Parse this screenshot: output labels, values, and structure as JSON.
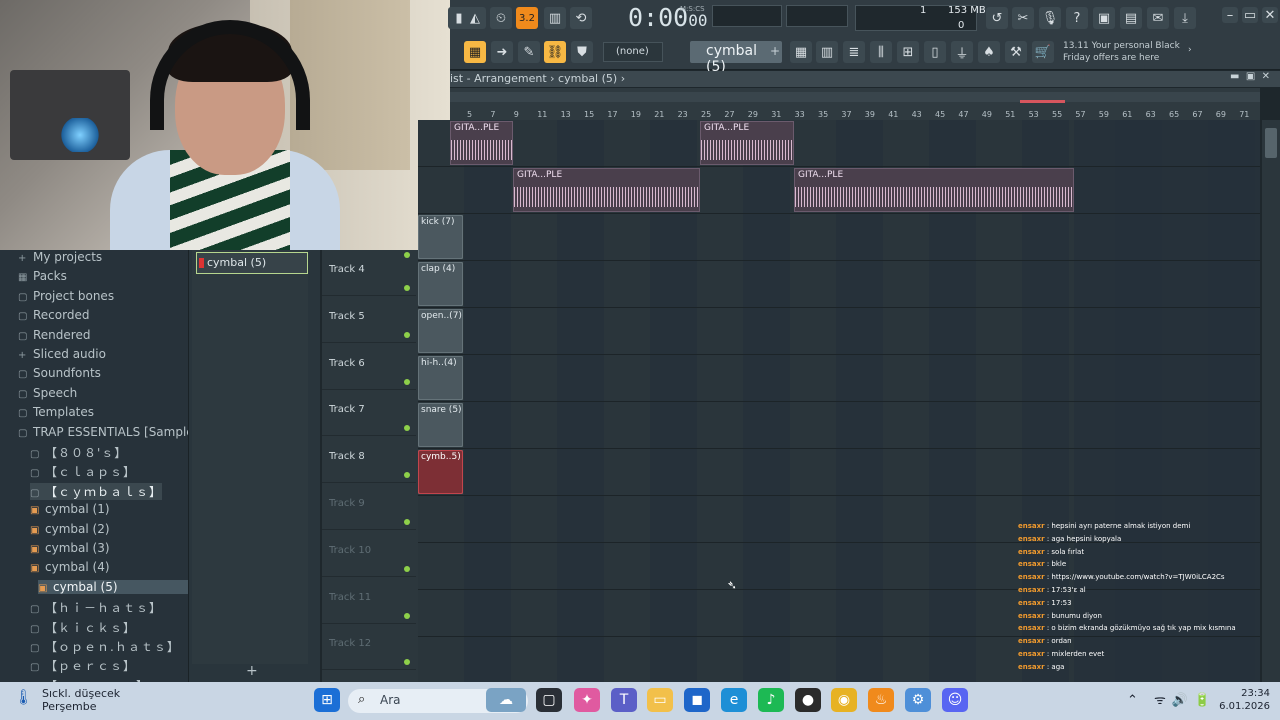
{
  "toolbar": {
    "time_main": "0:00",
    "time_frac": "00",
    "time_unit": "M:S:CS",
    "cpu_value": "1",
    "mem_value": "153 MB",
    "mem_zero": "0",
    "pattern_none": "(none)",
    "pattern_name": "cymbal (5)",
    "promo_line1": "13.11  Your personal Black",
    "promo_line2": "Friday offers are here",
    "tempo_badge": "3.2"
  },
  "playlist": {
    "title": "ist - Arrangement › cymbal (5) ›",
    "ruler_ticks": [
      "5",
      "7",
      "9",
      "11",
      "13",
      "15",
      "17",
      "19",
      "21",
      "23",
      "25",
      "27",
      "29",
      "31",
      "33",
      "35",
      "37",
      "39",
      "41",
      "43",
      "45",
      "47",
      "49",
      "51",
      "53",
      "55",
      "57",
      "59",
      "61",
      "63",
      "65",
      "67",
      "69",
      "71"
    ],
    "tracks": [
      {
        "name": "Track 4",
        "clip": "clap (4)"
      },
      {
        "name": "Track 5",
        "clip": "open..(7)"
      },
      {
        "name": "Track 6",
        "clip": "hi-h..(4)"
      },
      {
        "name": "Track 7",
        "clip": "snare (5)"
      },
      {
        "name": "Track 8",
        "clip": "cymb..5)"
      },
      {
        "name": "Track 9"
      },
      {
        "name": "Track 10"
      },
      {
        "name": "Track 11"
      },
      {
        "name": "Track 12"
      }
    ],
    "kick_clip": "kick (7)",
    "kick_partial": "(7)",
    "audio_clip": "GITA...PLE",
    "red_clip": "cymb..5)"
  },
  "browser": {
    "items": [
      {
        "label": "My projects",
        "icon": "+"
      },
      {
        "label": "Packs",
        "icon": "▦"
      },
      {
        "label": "Project bones",
        "icon": "▢"
      },
      {
        "label": "Recorded",
        "icon": "▢"
      },
      {
        "label": "Rendered",
        "icon": "▢"
      },
      {
        "label": "Sliced audio",
        "icon": "+"
      },
      {
        "label": "Soundfonts",
        "icon": "▢"
      },
      {
        "label": "Speech",
        "icon": "▢"
      },
      {
        "label": "Templates",
        "icon": "▢"
      },
      {
        "label": "TRAP ESSENTIALS [Sample Pack]",
        "icon": "▢"
      },
      {
        "label": "【８０８'ｓ】",
        "icon": "▢"
      },
      {
        "label": "【ｃｌａｐｓ】",
        "icon": "▢"
      },
      {
        "label": "【ｃｙｍｂａｌｓ】",
        "icon": "▢"
      },
      {
        "label": "cymbal (1)",
        "icon": "▣"
      },
      {
        "label": "cymbal (2)",
        "icon": "▣"
      },
      {
        "label": "cymbal (3)",
        "icon": "▣"
      },
      {
        "label": "cymbal (4)",
        "icon": "▣"
      },
      {
        "label": "cymbal (5)",
        "icon": "▣"
      },
      {
        "label": "【ｈｉ－ｈａｔｓ】",
        "icon": "▢"
      },
      {
        "label": "【ｋｉｃｋｓ】",
        "icon": "▢"
      },
      {
        "label": "【ｏｐｅｎ.ｈａｔｓ】",
        "icon": "▢"
      },
      {
        "label": "【ｐｅｒｃｓ】",
        "icon": "▢"
      },
      {
        "label": "【ｓｎａｒｅｓ】",
        "icon": "▢"
      }
    ]
  },
  "channel": {
    "item": "cymbal (5)",
    "add": "+"
  },
  "chat": [
    {
      "user": "ensaxr",
      "msg": ": hepsini ayrı paterne almak istiyon demi"
    },
    {
      "user": "ensaxr",
      "msg": ": aga hepsini kopyala"
    },
    {
      "user": "ensaxr",
      "msg": ": sola fırlat"
    },
    {
      "user": "ensaxr",
      "msg": ": bkle"
    },
    {
      "user": "ensaxr",
      "msg": ": https://www.youtube.com/watch?v=TJW0iLCA2Cs"
    },
    {
      "user": "ensaxr",
      "msg": ": 17:53'ε al"
    },
    {
      "user": "ensaxr",
      "msg": ": 17:53"
    },
    {
      "user": "ensaxr",
      "msg": ": bunumu diyon"
    },
    {
      "user": "ensaxr",
      "msg": ": o bizim ekranda gözükmüyo sağ tık yap mix kısmına"
    },
    {
      "user": "ensaxr",
      "msg": ": ordan"
    },
    {
      "user": "ensaxr",
      "msg": ": mixlerden evet"
    },
    {
      "user": "ensaxr",
      "msg": ": aga"
    }
  ],
  "taskbar": {
    "weather_title": "Sıckl. düşecek",
    "weather_sub": "Perşembe",
    "search": "Ara",
    "time": "23:34",
    "date": "6.01.2026"
  }
}
